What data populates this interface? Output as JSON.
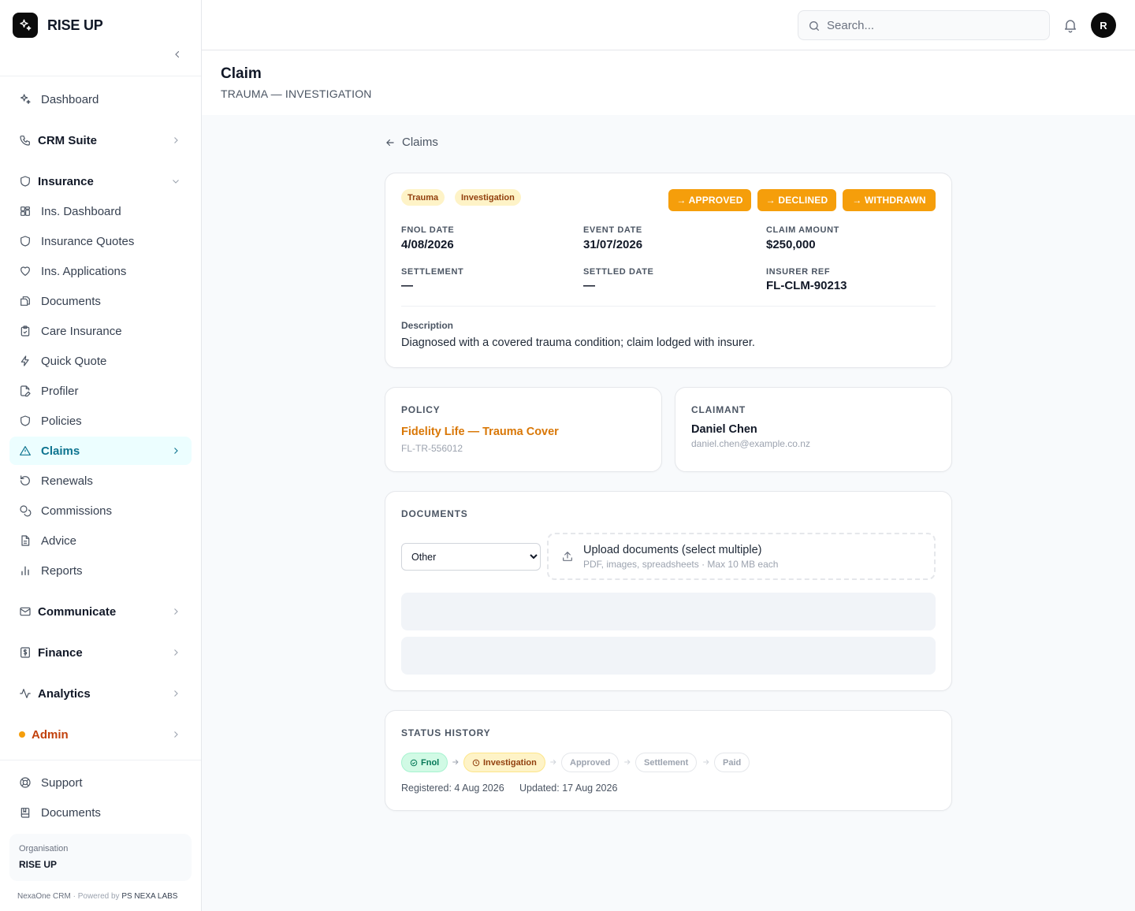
{
  "brand": {
    "name": "RISE UP"
  },
  "search": {
    "placeholder": "Search..."
  },
  "user": {
    "initial": "R"
  },
  "nav": {
    "dashboard": "Dashboard",
    "crm_suite": "CRM Suite",
    "insurance": "Insurance",
    "insurance_items": [
      "Ins. Dashboard",
      "Insurance Quotes",
      "Ins. Applications",
      "Documents",
      "Care Insurance",
      "Quick Quote",
      "Profiler",
      "Policies",
      "Claims",
      "Renewals",
      "Commissions",
      "Advice",
      "Reports"
    ],
    "communicate": "Communicate",
    "finance": "Finance",
    "analytics": "Analytics",
    "admin": "Admin",
    "support": "Support",
    "documents": "Documents"
  },
  "org": {
    "label": "Organisation",
    "name": "RISE UP"
  },
  "footer": {
    "product": "NexaOne CRM",
    "separator": "·",
    "powered_by": "Powered by",
    "company": "PS NEXA LABS"
  },
  "page": {
    "title": "Claim",
    "subtitle": "TRAUMA — INVESTIGATION"
  },
  "back": {
    "label": "Claims"
  },
  "claim": {
    "tags": [
      "Trauma",
      "Investigation"
    ],
    "actions": [
      "→ APPROVED",
      "→ DECLINED",
      "→ WITHDRAWN"
    ],
    "fields": [
      {
        "label": "FNOL DATE",
        "value": "4/08/2026"
      },
      {
        "label": "EVENT DATE",
        "value": "31/07/2026"
      },
      {
        "label": "CLAIM AMOUNT",
        "value": "$250,000"
      },
      {
        "label": "SETTLEMENT",
        "value": "—"
      },
      {
        "label": "SETTLED DATE",
        "value": "—"
      },
      {
        "label": "INSURER REF",
        "value": "FL-CLM-90213"
      }
    ],
    "description_label": "Description",
    "description": "Diagnosed with a covered trauma condition; claim lodged with insurer."
  },
  "policy": {
    "title": "POLICY",
    "name": "Fidelity Life — Trauma Cover",
    "ref": "FL-TR-556012"
  },
  "claimant": {
    "title": "CLAIMANT",
    "name": "Daniel Chen",
    "email": "daniel.chen@example.co.nz"
  },
  "documents": {
    "title": "DOCUMENTS",
    "type_selected": "Other",
    "upload_title": "Upload documents (select multiple)",
    "upload_sub": "PDF, images, spreadsheets · Max 10 MB each"
  },
  "history": {
    "title": "STATUS HISTORY",
    "steps": [
      "Fnol",
      "Investigation",
      "Approved",
      "Settlement",
      "Paid"
    ],
    "registered": "Registered: 4 Aug 2026",
    "updated": "Updated: 17 Aug 2026"
  },
  "colors": {
    "accent": "#f59e0b",
    "active_nav": "#0e7490",
    "policy_link": "#d97706"
  }
}
